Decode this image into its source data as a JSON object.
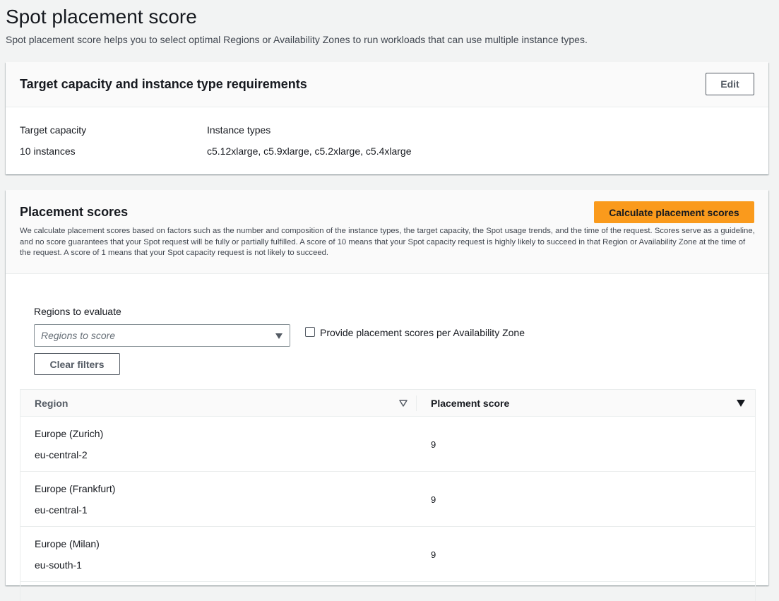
{
  "page": {
    "title": "Spot placement score",
    "description": "Spot placement score helps you to select optimal Regions or Availability Zones to run workloads that can use multiple instance types."
  },
  "requirements": {
    "title": "Target capacity and instance type requirements",
    "edit_label": "Edit",
    "target_capacity_label": "Target capacity",
    "target_capacity_value": "10 instances",
    "instance_types_label": "Instance types",
    "instance_types_value": "c5.12xlarge, c5.9xlarge, c5.2xlarge, c5.4xlarge"
  },
  "scores": {
    "title": "Placement scores",
    "calculate_label": "Calculate placement scores",
    "description": "We calculate placement scores based on factors such as the number and composition of the instance types, the target capacity, the Spot usage trends, and the time of the request. Scores serve as a guideline, and no score guarantees that your Spot request will be fully or partially fulfilled. A score of 10 means that your Spot capacity request is highly likely to succeed in that Region or Availability Zone at the time of the request. A score of 1 means that your Spot capacity request is not likely to succeed.",
    "regions_label": "Regions to evaluate",
    "regions_placeholder": "Regions to score",
    "az_checkbox_label": "Provide placement scores per Availability Zone",
    "az_checkbox_checked": false,
    "clear_filters_label": "Clear filters",
    "table": {
      "columns": [
        "Region",
        "Placement score"
      ],
      "rows": [
        {
          "region_name": "Europe (Zurich)",
          "region_code": "eu-central-2",
          "score": "9"
        },
        {
          "region_name": "Europe (Frankfurt)",
          "region_code": "eu-central-1",
          "score": "9"
        },
        {
          "region_name": "Europe (Milan)",
          "region_code": "eu-south-1",
          "score": "9"
        }
      ]
    }
  },
  "icons": {
    "region_sort": "sort-outline-icon",
    "score_sort": "sort-descending-icon",
    "select_caret": "caret-down-icon"
  },
  "colors": {
    "primary_button": "#fa9a1c",
    "background": "#f2f3f3"
  }
}
